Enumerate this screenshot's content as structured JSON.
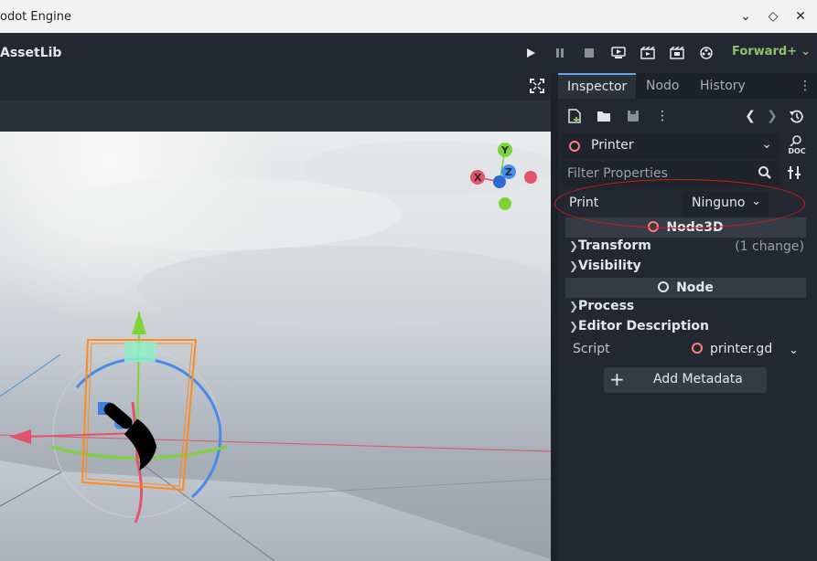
{
  "window": {
    "title": "odot Engine"
  },
  "topbar": {
    "assetlib_label": "AssetLib",
    "renderer": "Forward+"
  },
  "inspector": {
    "tabs": [
      {
        "label": "Inspector"
      },
      {
        "label": "Nodo"
      },
      {
        "label": "History"
      }
    ],
    "object_name": "Printer",
    "filter_placeholder": "Filter Properties",
    "print_label": "Print",
    "print_value": "Ninguno",
    "node3d_section": "Node3D",
    "node_section": "Node",
    "groups": {
      "transform": "Transform",
      "transform_note": "(1 change)",
      "visibility": "Visibility",
      "process": "Process",
      "editor_description": "Editor Description"
    },
    "script_label": "Script",
    "script_value": "printer.gd",
    "add_metadata": "Add Metadata",
    "doc_label": "DOC"
  },
  "gizmo": {
    "x": "X",
    "y": "Y",
    "z": "Z"
  },
  "colors": {
    "accent": "#6ba4e6",
    "renderer_green": "#8ec26b",
    "node3d_ring": "#fc7f7f",
    "highlight_red": "#d11a1a"
  }
}
